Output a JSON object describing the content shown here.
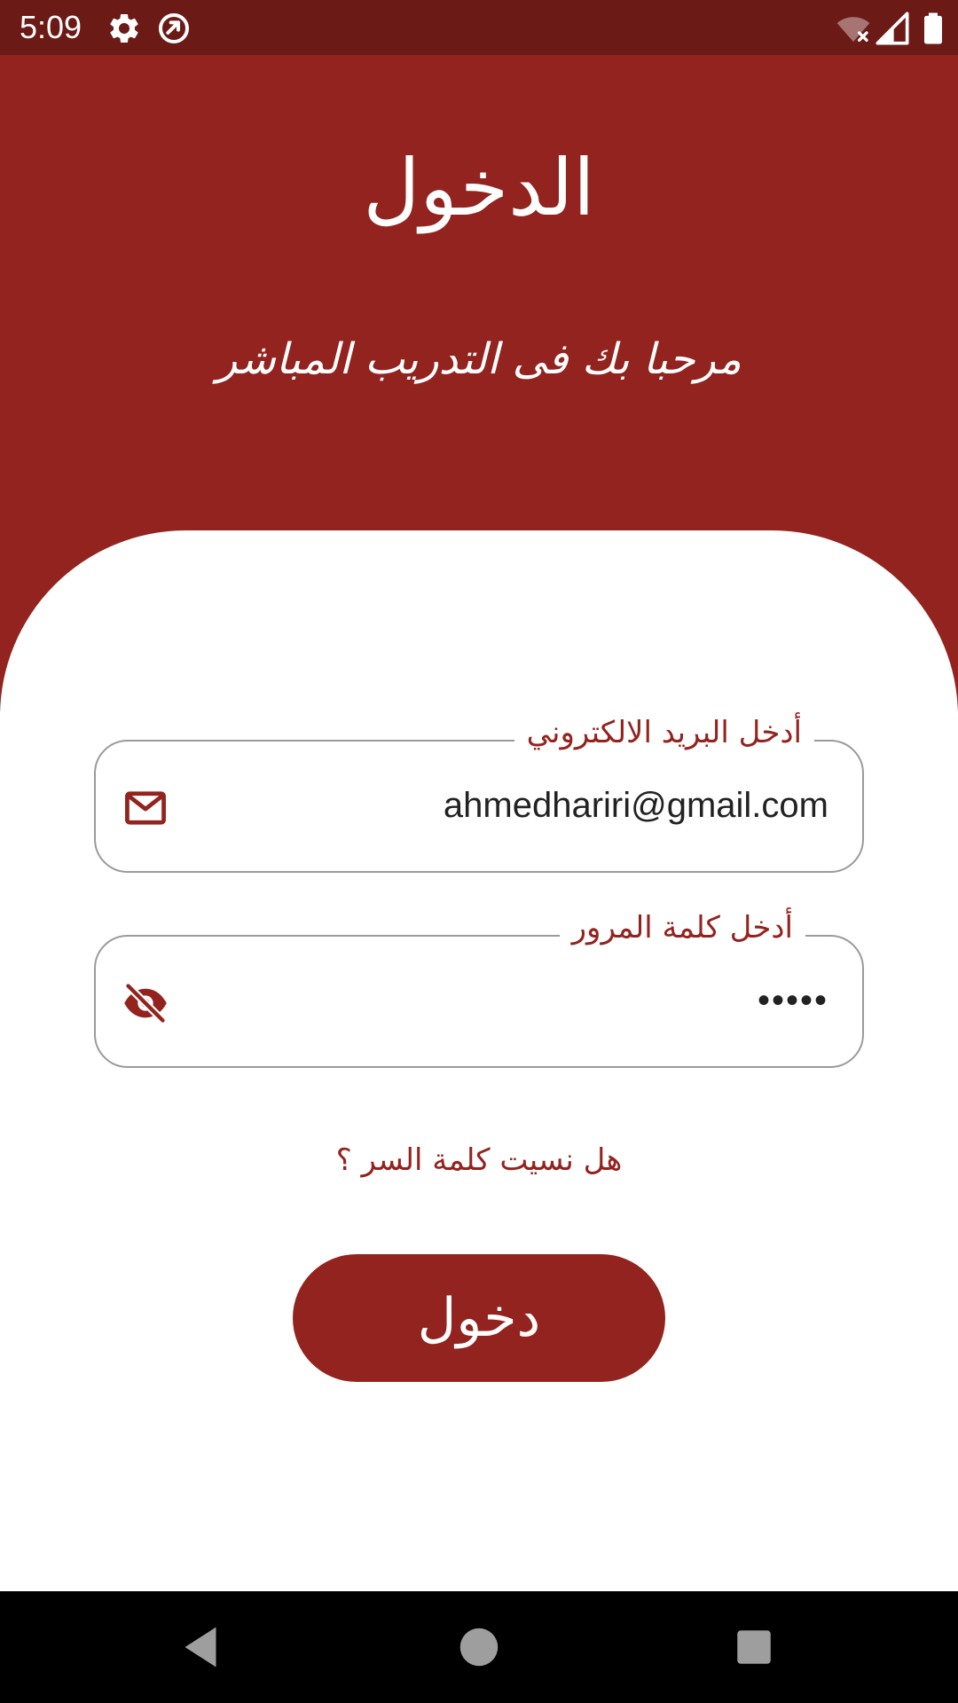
{
  "status_bar": {
    "time": "5:09",
    "icons": [
      "settings-icon",
      "sync-disabled-icon",
      "wifi-off-icon",
      "signal-icon",
      "battery-icon"
    ]
  },
  "header": {
    "title": "الدخول",
    "subtitle": "مرحبا بك فى التدريب المباشر"
  },
  "form": {
    "email": {
      "label": "أدخل البريد الالكتروني",
      "value": "ahmedhariri@gmail.com",
      "icon": "mail-icon"
    },
    "password": {
      "label": "أدخل كلمة المرور",
      "value": "•••••",
      "icon": "eye-off-icon"
    },
    "forgot_label": "هل نسيت كلمة السر ؟",
    "submit_label": "دخول"
  },
  "nav_bar": {
    "icons": [
      "back-icon",
      "home-icon",
      "recents-icon"
    ]
  },
  "colors": {
    "primary": "#93231e",
    "status_bar": "#6b1a16",
    "field_border": "#9a9a9a",
    "nav_bar": "#000000"
  }
}
